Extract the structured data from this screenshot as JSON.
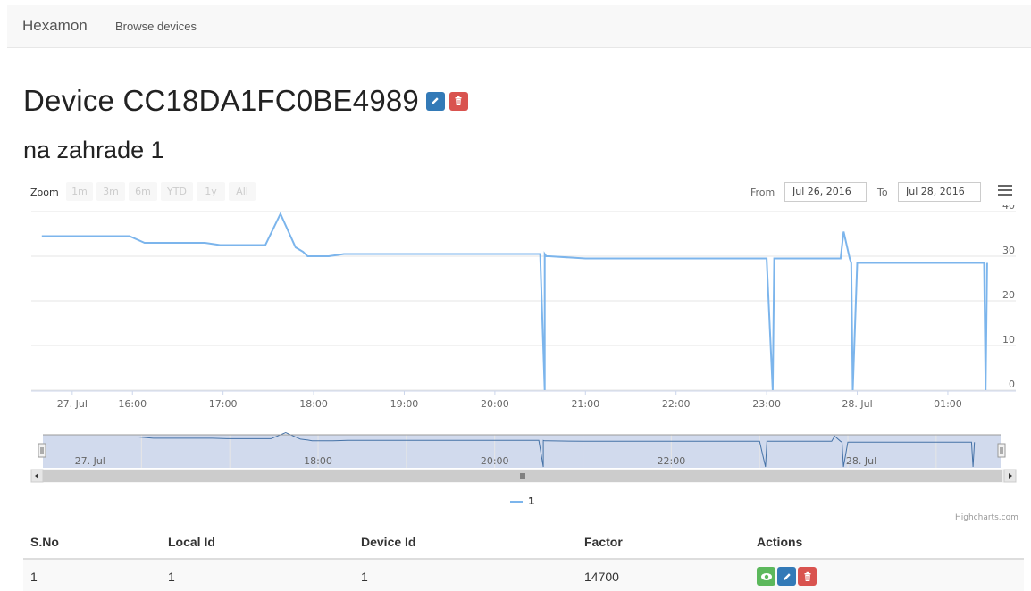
{
  "navbar": {
    "brand": "Hexamon",
    "links": [
      "Browse devices"
    ]
  },
  "page": {
    "title": "Device CC18DA1FC0BE4989",
    "subtitle": "na zahrade 1"
  },
  "range_selector": {
    "zoom_label": "Zoom",
    "buttons": [
      "1m",
      "3m",
      "6m",
      "YTD",
      "1y",
      "All"
    ],
    "from_label": "From",
    "from_value": "Jul 26, 2016",
    "to_label": "To",
    "to_value": "Jul 28, 2016"
  },
  "chart_data": {
    "type": "line",
    "series": [
      {
        "name": "1",
        "color": "#7cb5ec",
        "x": [
          "15:00",
          "15:08",
          "15:18",
          "15:28",
          "15:38",
          "15:48",
          "15:58",
          "16:08",
          "16:18",
          "16:28",
          "16:38",
          "16:48",
          "16:58",
          "17:08",
          "17:18",
          "17:28",
          "17:38",
          "17:48",
          "17:53",
          "17:56",
          "18:04",
          "18:10",
          "18:20",
          "18:30",
          "18:40",
          "18:50",
          "19:00",
          "19:30",
          "20:00",
          "20:30",
          "20:33",
          "20:33",
          "20:34",
          "20:36",
          "21:00",
          "21:30",
          "22:00",
          "22:30",
          "23:00",
          "23:04",
          "23:05",
          "23:06",
          "23:30",
          "23:46",
          "23:49",
          "23:51",
          "23:55",
          "23:56",
          "23:57",
          "24:00",
          "24:10",
          "24:30",
          "25:00",
          "25:24",
          "25:25",
          "25:26"
        ],
        "y": [
          34.5,
          34.5,
          34.5,
          34.5,
          34.5,
          34.5,
          34.5,
          33,
          33,
          33,
          33,
          33,
          32.5,
          32.5,
          32.5,
          32.5,
          39.5,
          32,
          31,
          30,
          30,
          30,
          30.5,
          30.5,
          30.5,
          30.5,
          30.5,
          30.5,
          30.5,
          30.5,
          0,
          30.5,
          30,
          30,
          29.5,
          29.5,
          29.5,
          29.5,
          29.5,
          0,
          29.5,
          29.5,
          29.5,
          29.5,
          29.5,
          35.5,
          29.5,
          28.5,
          0,
          28.5,
          28.5,
          28.5,
          28.5,
          28.5,
          0,
          28.5
        ],
        "dips_annotation": []
      }
    ],
    "x_ticks": [
      "27. Jul",
      "16:00",
      "17:00",
      "18:00",
      "19:00",
      "20:00",
      "21:00",
      "22:00",
      "23:00",
      "28. Jul",
      "01:00"
    ],
    "y_ticks": [
      "0",
      "10",
      "20",
      "30",
      "40"
    ],
    "ylim": [
      0,
      40
    ],
    "navigator_ticks": [
      "27. Jul",
      "18:00",
      "20:00",
      "22:00",
      "28. Jul"
    ],
    "legend": "1",
    "credits": "Highcharts.com",
    "grid": true
  },
  "table": {
    "headers": [
      "S.No",
      "Local Id",
      "Device Id",
      "Factor",
      "Actions"
    ],
    "rows": [
      [
        "1",
        "1",
        "1",
        "14700"
      ]
    ]
  },
  "colors": {
    "series": "#7cb5ec",
    "primary": "#337ab7",
    "danger": "#d9534f",
    "success": "#5cb85c"
  }
}
